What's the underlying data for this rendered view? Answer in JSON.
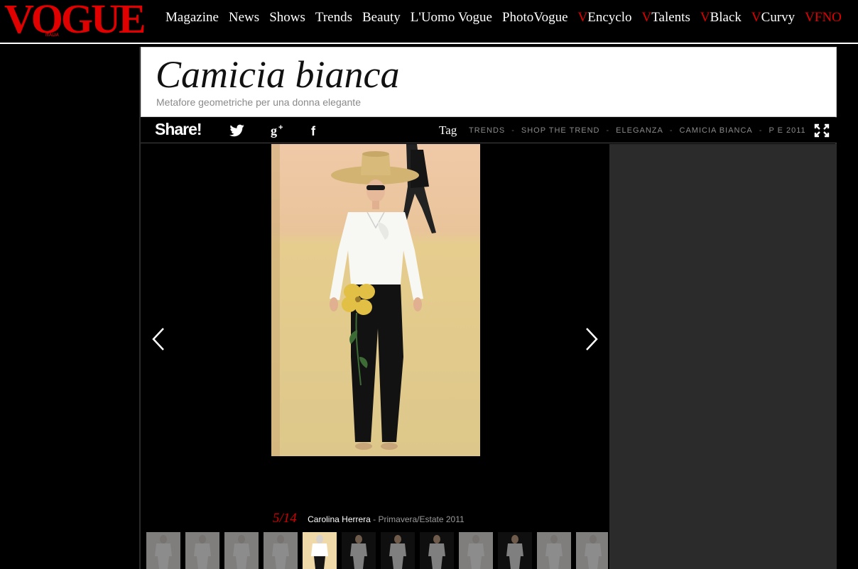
{
  "logo": {
    "text": "VOGUE",
    "subtext": "ITALIA",
    "color": "#e00000"
  },
  "nav": {
    "items": [
      {
        "prefix": "",
        "label": "Magazine"
      },
      {
        "prefix": "",
        "label": "News"
      },
      {
        "prefix": "",
        "label": "Shows"
      },
      {
        "prefix": "",
        "label": "Trends"
      },
      {
        "prefix": "",
        "label": "Beauty"
      },
      {
        "prefix": "",
        "label": "L'Uomo Vogue"
      },
      {
        "prefix": "",
        "label": "PhotoVogue"
      },
      {
        "prefix": "V",
        "label": "Encyclo"
      },
      {
        "prefix": "V",
        "label": "Talents"
      },
      {
        "prefix": "V",
        "label": "Black"
      },
      {
        "prefix": "V",
        "label": "Curvy"
      },
      {
        "prefix": "",
        "label": "VFNO"
      }
    ]
  },
  "header": {
    "title": "Camicia bianca",
    "subtitle": "Metafore geometriche per una donna elegante"
  },
  "share": {
    "label": "Share!",
    "icons": [
      "twitter-icon",
      "google-plus-icon",
      "facebook-icon"
    ]
  },
  "tags": {
    "label": "Tag",
    "items": [
      "TRENDS",
      "SHOP THE TREND",
      "ELEGANZA",
      "CAMICIA BIANCA",
      "P E 2011"
    ],
    "separator": "-"
  },
  "gallery": {
    "counter": "5/14",
    "designer": "Carolina Herrera",
    "season": " - Primavera/Estate 2011",
    "active_index": 4,
    "thumbnail_count": 12,
    "dark_thumbnails": [
      5,
      6,
      7,
      9
    ]
  },
  "colors": {
    "accent": "#e00000",
    "sidepanel": "#2b2b2b",
    "tag_text": "#8a8a8a"
  }
}
